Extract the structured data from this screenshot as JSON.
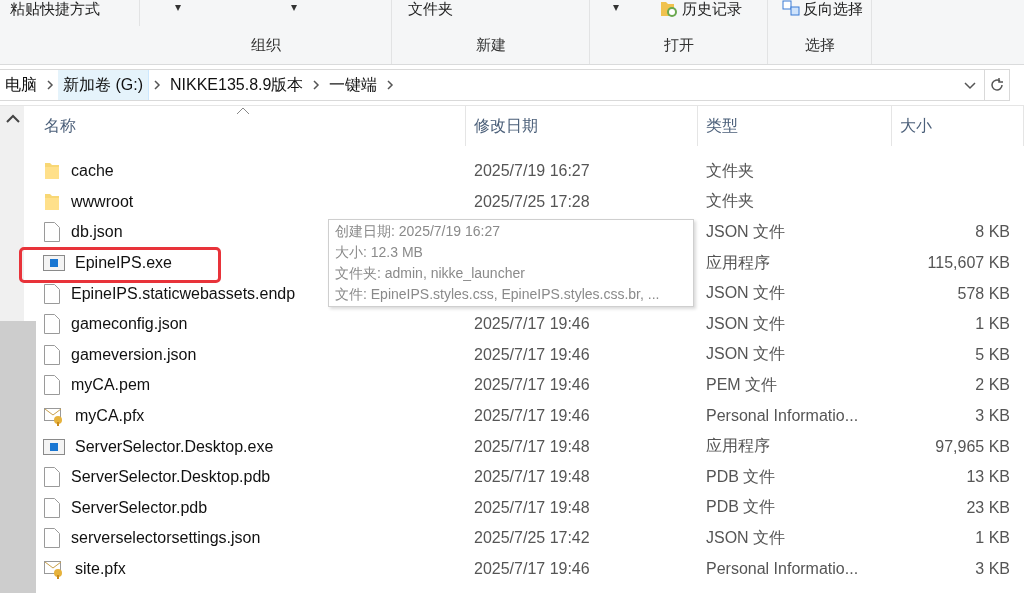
{
  "ribbon": {
    "top_items": [
      {
        "kind": "text",
        "label": "粘贴快捷方式"
      },
      {
        "kind": "arrow",
        "label": "▾"
      },
      {
        "kind": "arrow",
        "label": "▾"
      },
      {
        "kind": "text",
        "label": "文件夹"
      },
      {
        "kind": "arrow",
        "label": "▾"
      },
      {
        "kind": "history",
        "label": "历史记录"
      },
      {
        "kind": "select",
        "label": "反向选择"
      }
    ],
    "groups": [
      "组织",
      "新建",
      "打开",
      "选择"
    ]
  },
  "address_bar": {
    "segments": [
      {
        "label": "电脑",
        "selected": false
      },
      {
        "label": "新加卷 (G:)",
        "selected": true
      },
      {
        "label": "NIKKE135.8.9版本",
        "selected": false
      },
      {
        "label": "一键端",
        "selected": false
      }
    ]
  },
  "table": {
    "columns": [
      "名称",
      "修改日期",
      "类型",
      "大小"
    ],
    "rows": [
      {
        "kind": "folder",
        "name": "cache",
        "date": "2025/7/19 16:27",
        "type": "文件夹",
        "highlighted": false
      },
      {
        "kind": "folder",
        "name": "wwwroot",
        "date": "2025/7/25 17:28",
        "type": "文件夹",
        "highlighted": false
      },
      {
        "kind": "file",
        "name": "db.json",
        "type": "JSON 文件",
        "size": "8 KB",
        "highlighted": false
      },
      {
        "kind": "exe",
        "name": "EpineIPS.exe",
        "type": "应用程序",
        "size": "115,607 KB",
        "highlighted": true
      },
      {
        "kind": "file",
        "name": "EpineIPS.staticwebassets.endp",
        "type": "JSON 文件",
        "size": "578 KB",
        "highlighted": false
      },
      {
        "kind": "file",
        "name": "gameconfig.json",
        "date": "2025/7/17 19:46",
        "type": "JSON 文件",
        "size": "1 KB",
        "highlighted": false
      },
      {
        "kind": "file",
        "name": "gameversion.json",
        "date": "2025/7/17 19:46",
        "type": "JSON 文件",
        "size": "5 KB",
        "highlighted": false
      },
      {
        "kind": "file",
        "name": "myCA.pem",
        "date": "2025/7/17 19:46",
        "type": "PEM 文件",
        "size": "2 KB",
        "highlighted": false
      },
      {
        "kind": "cert",
        "name": "myCA.pfx",
        "date": "2025/7/17 19:46",
        "type": "Personal Informatio...",
        "size": "3 KB",
        "highlighted": false
      },
      {
        "kind": "exe",
        "name": "ServerSelector.Desktop.exe",
        "date": "2025/7/17 19:48",
        "type": "应用程序",
        "size": "97,965 KB",
        "highlighted": false
      },
      {
        "kind": "file",
        "name": "ServerSelector.Desktop.pdb",
        "date": "2025/7/17 19:48",
        "type": "PDB 文件",
        "size": "13 KB",
        "highlighted": false
      },
      {
        "kind": "file",
        "name": "ServerSelector.pdb",
        "date": "2025/7/17 19:48",
        "type": "PDB 文件",
        "size": "23 KB",
        "highlighted": false
      },
      {
        "kind": "file",
        "name": "serverselectorsettings.json",
        "date": "2025/7/25 17:42",
        "type": "JSON 文件",
        "size": "1 KB",
        "highlighted": false
      },
      {
        "kind": "cert",
        "name": "site.pfx",
        "date": "2025/7/17 19:46",
        "type": "Personal Informatio...",
        "size": "3 KB",
        "highlighted": false
      }
    ]
  },
  "tooltip": {
    "lines": [
      "创建日期: 2025/7/19 16:27",
      "大小: 12.3 MB",
      "文件夹: admin, nikke_launcher",
      "文件: EpineIPS.styles.css, EpineIPS.styles.css.br, ..."
    ]
  }
}
